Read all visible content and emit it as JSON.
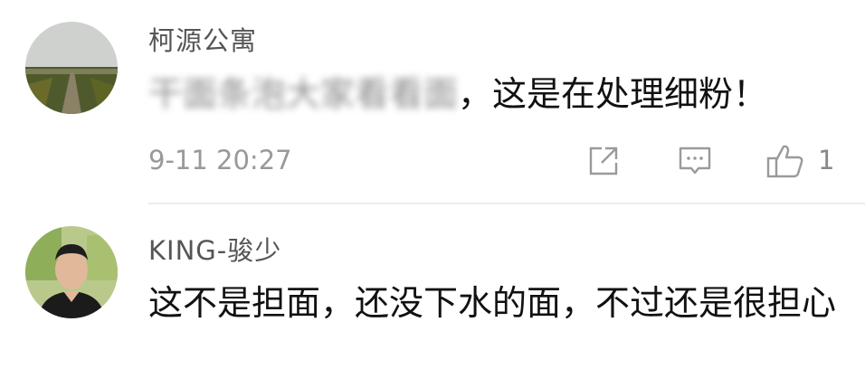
{
  "comments": [
    {
      "username": "柯源公寓",
      "text_blurred": "干面条泡大家看看面",
      "text_visible": "，这是在处理细粉！",
      "time": "9-11 20:27",
      "likes": "1",
      "avatar_icon": "landscape-field-avatar"
    },
    {
      "username": "KING-骏少",
      "text": "这不是担面，还没下水的面，不过还是很担心",
      "avatar_icon": "man-portrait-avatar"
    }
  ],
  "icons": {
    "share": "share-icon",
    "reply": "comment-icon",
    "like": "thumbs-up-icon"
  }
}
